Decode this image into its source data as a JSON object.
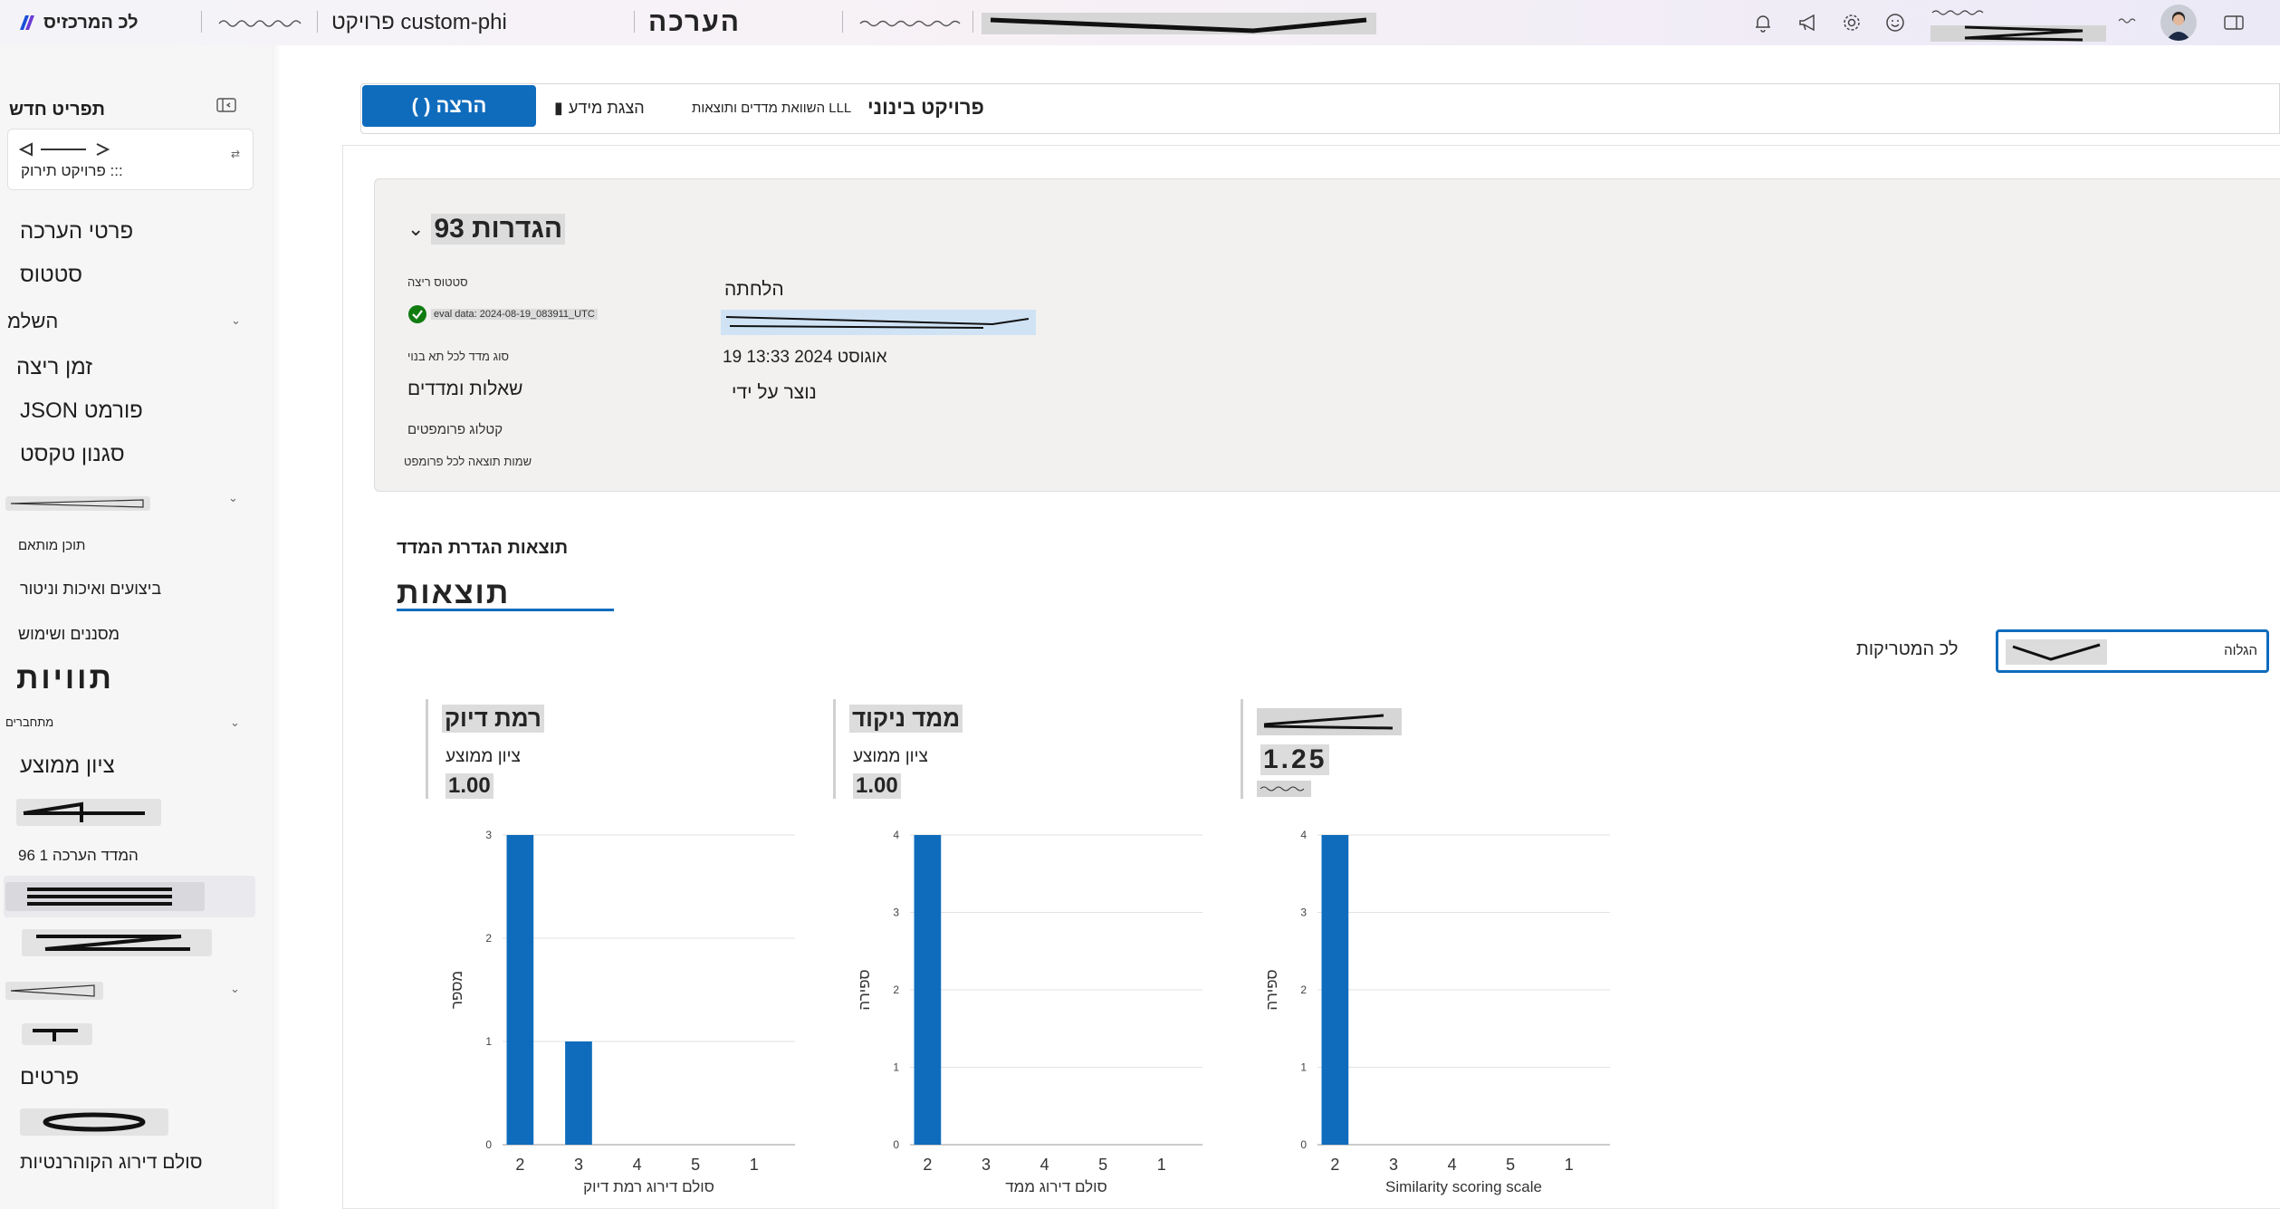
{
  "topbar": {
    "app_name": "לכ המרכזיס",
    "crumb_1": "פרויקט custom-phi",
    "crumb_2": "הערכה"
  },
  "sidebar": {
    "header": "תפריט חדש",
    "collapse_icon": "collapse-icon",
    "project_kind": "פרויקט תירוק :::",
    "items": {
      "eval_details": "פרטי הערכה",
      "status": "סטטוס",
      "section_1": "השלמ",
      "model_run": "זמן ריצה",
      "json_format": "JSON פורמט",
      "sign_text": "סגנון טקסט",
      "sub_label": "תוכן מותאם",
      "checks": "ביצועים ואיכות וניטור",
      "input_metrics": "מסננים ושימוש",
      "labels": "תוויות",
      "section_2_head": "מתחברים",
      "coherence": "ציון ממוצע",
      "eval_progress": "המדד הערכה 1 96",
      "section_3_head": "שנייה",
      "details": "פרטים",
      "grounding_scale": "סולם דירוג הקוהרנטיות"
    }
  },
  "toolbar": {
    "primary_label": "( ) הרצה",
    "btn_view": "הצגת מידע",
    "btn_compare": "השוואת מדדים ותוצאות LLL",
    "btn_project": "פרויקט בינוני"
  },
  "details": {
    "title": "הגדרות 93",
    "labels": {
      "status": "סטטוס ריצה",
      "status_value": "eval data: 2024-08-19_083911_UTC",
      "metric_model": "סוג מדד לכל תא בנוי",
      "dataset": "קטלוג פרומפטים",
      "annotations": "שמות תוצאה לכל פרומפט"
    },
    "values": {
      "metric_model": "שאלות ומדדים",
      "created_label": "הלחתה",
      "created_on": "19 אוגוסט 2024 13:33",
      "created_by": "נוצר על ידי"
    }
  },
  "metrics_section": {
    "title": "תוצאות הגדרת המדד",
    "tab": "תוצאות"
  },
  "filter": {
    "label": "לכ המטריקות",
    "value": "הגלוה"
  },
  "metric_cards": [
    {
      "name": "רמת דיוק",
      "sub": "ציון ממוצע",
      "value": "1.00",
      "y_label": "מספר"
    },
    {
      "name": "ממד ניקוד",
      "sub": "ציון ממוצע",
      "value": "1.00",
      "y_label": "ספירה"
    },
    {
      "name": "",
      "sub": "",
      "value": "1.25",
      "y_label": "ספירה"
    }
  ],
  "chart_data": [
    {
      "type": "bar",
      "categories": [
        "2",
        "3",
        "4",
        "5",
        "1"
      ],
      "values": [
        3,
        1,
        0,
        0,
        0
      ],
      "ylim": [
        0,
        3
      ],
      "yticks": [
        "0",
        "1",
        "2",
        "3"
      ],
      "xlabel": "סולם דירוג רמת דיוק",
      "ylabel": "מספר",
      "color": "#0f6cbd"
    },
    {
      "type": "bar",
      "categories": [
        "2",
        "3",
        "4",
        "5",
        "1"
      ],
      "values": [
        4,
        0,
        0,
        0,
        0
      ],
      "ylim": [
        0,
        4
      ],
      "yticks": [
        "0",
        "1",
        "2",
        "3",
        "4"
      ],
      "xlabel": "סולם דירוג ממד",
      "ylabel": "ספירה",
      "color": "#0f6cbd"
    },
    {
      "type": "bar",
      "categories": [
        "2",
        "3",
        "4",
        "5",
        "1"
      ],
      "values": [
        4,
        0,
        0,
        0,
        0
      ],
      "ylim": [
        0,
        4
      ],
      "yticks": [
        "0",
        "1",
        "2",
        "3",
        "4"
      ],
      "xlabel": "Similarity scoring scale",
      "ylabel": "ספירה",
      "color": "#0f6cbd"
    }
  ]
}
